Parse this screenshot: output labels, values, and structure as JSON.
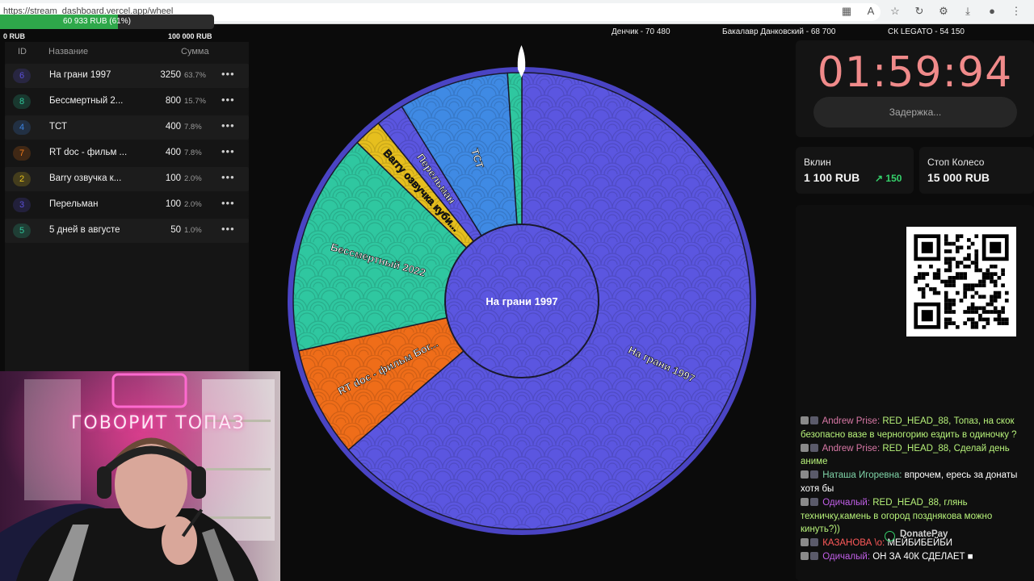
{
  "browser": {
    "url": "https://stream_dashboard.vercel.app/wheel"
  },
  "progress": {
    "text": "60 933 RUB (61%)",
    "fraction": 0.61,
    "min_label": "0 RUB",
    "max_label": "100 000 RUB"
  },
  "top_donors": [
    {
      "text": "Денчик - 70 480"
    },
    {
      "text": "Бакалавр Данковский - 68 700"
    },
    {
      "text": "СК LEGATO - 54 150"
    }
  ],
  "lots": {
    "headers": {
      "id": "ID",
      "name": "Название",
      "amount": "Сумма"
    },
    "rows": [
      {
        "id": "6",
        "name": "На грани 1997",
        "amount": "3250",
        "pct": "63.7%",
        "color": "#5a4fd8"
      },
      {
        "id": "8",
        "name": "Бессмертный 2...",
        "amount": "800",
        "pct": "15.7%",
        "color": "#2fc79a"
      },
      {
        "id": "4",
        "name": "ТСТ",
        "amount": "400",
        "pct": "7.8%",
        "color": "#3b82e0"
      },
      {
        "id": "7",
        "name": "RT doc - фильм ...",
        "amount": "400",
        "pct": "7.8%",
        "color": "#f07a1a"
      },
      {
        "id": "2",
        "name": "Barry озвучка к...",
        "amount": "100",
        "pct": "2.0%",
        "color": "#e6c21e"
      },
      {
        "id": "3",
        "name": "Перельман",
        "amount": "100",
        "pct": "2.0%",
        "color": "#5a4fd8"
      },
      {
        "id": "5",
        "name": "5 дней в августе",
        "amount": "50",
        "pct": "1.0%",
        "color": "#2fc79a"
      }
    ],
    "menu_glyph": "•••"
  },
  "wheel": {
    "center_label": "На грани 1997",
    "segments": [
      {
        "label": "На грани 1997",
        "pct": 63.7,
        "color": "#5b56e0"
      },
      {
        "label": "RT doc - фильм Бог...",
        "pct": 7.8,
        "color": "#ef6d19"
      },
      {
        "label": "Бессмертный 2022",
        "pct": 15.7,
        "color": "#2fc7a0"
      },
      {
        "label": "Barry озвучка куби...",
        "pct": 2.0,
        "color": "#e6bf1e"
      },
      {
        "label": "Перельман",
        "pct": 2.0,
        "color": "#5b56e0"
      },
      {
        "label": "ТСТ",
        "pct": 7.8,
        "color": "#3f8ae4"
      },
      {
        "label": "",
        "pct": 1.0,
        "color": "#2fc7a0"
      }
    ]
  },
  "timer": {
    "value": "01:59:94",
    "delay_button": "Задержка..."
  },
  "stats": {
    "vklin_label": "Вклин",
    "vklin_value": "1 100 RUB",
    "vklin_delta": "↗ 150",
    "stop_label": "Стоп Колесо",
    "stop_value": "15 000 RUB"
  },
  "chat": [
    {
      "author": "Andrew Prise:",
      "author_color": "#d978a6",
      "text": "RED_HEAD_88, Топаз, на скок безопасно вазе в черногорию ездить в одиночку ?",
      "text_color": "#b7f27a"
    },
    {
      "author": "Andrew Prise:",
      "author_color": "#d978a6",
      "text": "RED_HEAD_88, Сделай день аниме",
      "text_color": "#b7f27a"
    },
    {
      "author": "Наташа Игоревна:",
      "author_color": "#7fd4a8",
      "text": "впрочем, ересь за донаты хотя бы",
      "text_color": "#ffffff"
    },
    {
      "author": "Одичалый:",
      "author_color": "#c15fe8",
      "text": "RED_HEAD_88, глянь техничку,камень в огород позднякова можно кинуть?))",
      "text_color": "#b7f27a"
    },
    {
      "author": "КАЗАНОВА \\o:",
      "author_color": "#ff5a5a",
      "text": "МЕЙБИБЕЙБИ",
      "text_color": "#ffffff"
    },
    {
      "author": "Одичалый:",
      "author_color": "#c15fe8",
      "text": "ОН ЗА 40К СДЕЛАЕТ ■",
      "text_color": "#ffffff"
    }
  ],
  "donatepay_label": "DonatePay",
  "webcam": {
    "sign": "ГОВОРИТ ТОПАЗ"
  }
}
